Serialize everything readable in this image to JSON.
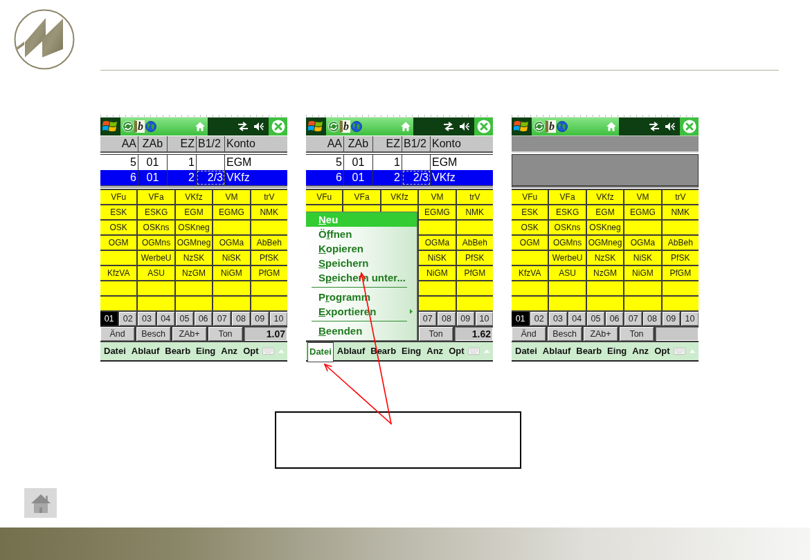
{
  "screens": [
    {
      "taskbar": {
        "app_badge": "b"
      },
      "table": {
        "columns": [
          "AA",
          "ZAb",
          "EZ",
          "B1/2",
          "Konto"
        ],
        "rows": [
          {
            "selected": false,
            "cells": [
              {
                "text": "5",
                "focused": false
              },
              {
                "text": "01",
                "focused": false
              },
              {
                "text": "1",
                "focused": false
              },
              {
                "focused": false
              },
              {
                "text": "EGM",
                "focused": false
              }
            ]
          },
          {
            "selected": true,
            "cells": [
              {
                "text": "6",
                "focused": false
              },
              {
                "text": "01",
                "focused": false
              },
              {
                "text": "2",
                "focused": false
              },
              {
                "text": "2/3",
                "focused": true
              },
              {
                "text": "VKfz",
                "focused": false
              }
            ]
          }
        ]
      },
      "grid": [
        [
          {
            "kind": "account",
            "label": "VFu"
          },
          {
            "kind": "account",
            "label": "VFa"
          },
          {
            "kind": "account",
            "label": "VKfz"
          },
          {
            "kind": "account",
            "label": "VM"
          },
          {
            "kind": "account",
            "label": "trV"
          }
        ],
        [
          {
            "kind": "account",
            "label": "ESK"
          },
          {
            "kind": "account",
            "label": "ESKG"
          },
          {
            "kind": "account",
            "label": "EGM"
          },
          {
            "kind": "account",
            "label": "EGMG"
          },
          {
            "kind": "account",
            "label": "NMK"
          }
        ],
        [
          {
            "kind": "account",
            "label": "OSK"
          },
          {
            "kind": "account",
            "label": "OSKns"
          },
          {
            "kind": "account",
            "label": "OSKneg"
          },
          {
            "kind": "blank"
          },
          {
            "kind": "blank"
          }
        ],
        [
          {
            "kind": "account",
            "label": "OGM"
          },
          {
            "kind": "account",
            "label": "OGMns"
          },
          {
            "kind": "account",
            "label": "OGMneg"
          },
          {
            "kind": "account",
            "label": "OGMa"
          },
          {
            "kind": "account",
            "label": "AbBeh"
          }
        ],
        [
          {
            "kind": "blank"
          },
          {
            "kind": "account",
            "label": "WerbeU"
          },
          {
            "kind": "account",
            "label": "NzSK"
          },
          {
            "kind": "account",
            "label": "NiSK"
          },
          {
            "kind": "account",
            "label": "PfSK"
          }
        ],
        [
          {
            "kind": "account",
            "label": "KfzVA"
          },
          {
            "kind": "account",
            "label": "ASU"
          },
          {
            "kind": "account",
            "label": "NzGM"
          },
          {
            "kind": "account",
            "label": "NiGM"
          },
          {
            "kind": "account",
            "label": "PfGM"
          }
        ],
        [
          {
            "kind": "blank"
          },
          {
            "kind": "blank"
          },
          {
            "kind": "blank"
          },
          {
            "kind": "blank"
          },
          {
            "kind": "blank"
          }
        ],
        [
          {
            "kind": "blank"
          },
          {
            "kind": "blank"
          },
          {
            "kind": "blank"
          },
          {
            "kind": "blank"
          },
          {
            "kind": "blank"
          }
        ]
      ],
      "tabs": [
        {
          "label": "01",
          "selected": true
        },
        {
          "label": "02",
          "selected": false
        },
        {
          "label": "03",
          "selected": false
        },
        {
          "label": "04",
          "selected": false
        },
        {
          "label": "05",
          "selected": false
        },
        {
          "label": "06",
          "selected": false
        },
        {
          "label": "07",
          "selected": false
        },
        {
          "label": "08",
          "selected": false
        },
        {
          "label": "09",
          "selected": false
        },
        {
          "label": "10",
          "selected": false
        }
      ],
      "buttons": [
        "Änd",
        "Besch",
        "ZAb+",
        "Ton"
      ],
      "value": "1.07",
      "menu_bar": [
        {
          "label": "Datei",
          "selected": false
        },
        {
          "label": "Ablauf",
          "selected": false
        },
        {
          "label": "Bearb",
          "selected": false
        },
        {
          "label": "Eing",
          "selected": false
        },
        {
          "label": "Anz",
          "selected": false
        },
        {
          "label": "Opt",
          "selected": false
        }
      ]
    },
    {
      "taskbar": {
        "app_badge": "b"
      },
      "table": {
        "columns": [
          "AA",
          "ZAb",
          "EZ",
          "B1/2",
          "Konto"
        ],
        "rows": [
          {
            "selected": false,
            "cells": [
              {
                "text": "5",
                "focused": false
              },
              {
                "text": "01",
                "focused": false
              },
              {
                "text": "1",
                "focused": false
              },
              {
                "focused": false
              },
              {
                "text": "EGM",
                "focused": false
              }
            ]
          },
          {
            "selected": true,
            "cells": [
              {
                "text": "6",
                "focused": false
              },
              {
                "text": "01",
                "focused": false
              },
              {
                "text": "2",
                "focused": false
              },
              {
                "text": "2/3",
                "focused": true
              },
              {
                "text": "VKfz",
                "focused": false
              }
            ]
          }
        ]
      },
      "grid": [
        [
          {
            "kind": "account",
            "label": "VFu"
          },
          {
            "kind": "account",
            "label": "VFa"
          },
          {
            "kind": "account",
            "label": "VKfz"
          },
          {
            "kind": "account",
            "label": "VM"
          },
          {
            "kind": "account",
            "label": "trV"
          }
        ],
        [
          {
            "kind": "account",
            "label": "EGMG"
          },
          {
            "kind": "account",
            "label": "NMK"
          }
        ],
        [
          {
            "kind": "blank"
          },
          {
            "kind": "blank"
          }
        ],
        [
          {
            "kind": "account",
            "label": "OGMa"
          },
          {
            "kind": "account",
            "label": "AbBeh"
          }
        ],
        [
          {
            "kind": "account",
            "label": "NiSK"
          },
          {
            "kind": "account",
            "label": "PfSK"
          }
        ],
        [
          {
            "kind": "account",
            "label": "NiGM"
          },
          {
            "kind": "account",
            "label": "PfGM"
          }
        ],
        [
          {
            "kind": "blank"
          },
          {
            "kind": "blank"
          }
        ],
        [
          {
            "kind": "blank"
          },
          {
            "kind": "blank"
          }
        ]
      ],
      "tabs": [
        {
          "label": "07",
          "selected": false
        },
        {
          "label": "08",
          "selected": false
        },
        {
          "label": "09",
          "selected": false
        },
        {
          "label": "10",
          "selected": false
        }
      ],
      "buttons": [
        "Ton"
      ],
      "value": "1.62",
      "menu": {
        "items": [
          {
            "kind": "item",
            "key": "N",
            "post": "eu",
            "selected": true,
            "submenu": false
          },
          {
            "kind": "item",
            "pre": "Ö",
            "key": "f",
            "post": "fnen",
            "selected": false,
            "submenu": false
          },
          {
            "kind": "item",
            "key": "K",
            "post": "opieren",
            "selected": false,
            "submenu": false
          },
          {
            "kind": "item",
            "key": "S",
            "post": "peichern",
            "selected": false,
            "submenu": false
          },
          {
            "kind": "item",
            "pre": "S",
            "key": "p",
            "post": "eichern unter...",
            "selected": false,
            "submenu": false
          },
          {
            "kind": "separator"
          },
          {
            "kind": "item",
            "pre": "P",
            "key": "r",
            "post": "ogramm",
            "selected": false,
            "submenu": false
          },
          {
            "kind": "item",
            "key": "E",
            "post": "xportieren",
            "selected": false,
            "submenu": true
          },
          {
            "kind": "separator"
          },
          {
            "kind": "item",
            "key": "B",
            "post": "eenden",
            "selected": false,
            "submenu": false
          }
        ]
      },
      "menu_bar": [
        {
          "label": "Datei",
          "selected": true
        },
        {
          "label": "Ablauf",
          "selected": false
        },
        {
          "label": "Bearb",
          "selected": false
        },
        {
          "label": "Eing",
          "selected": false
        },
        {
          "label": "Anz",
          "selected": false
        },
        {
          "label": "Opt",
          "selected": false
        }
      ]
    },
    {
      "taskbar": {
        "app_badge": "b"
      },
      "grid": [
        [
          {
            "kind": "account",
            "label": "VFu"
          },
          {
            "kind": "account",
            "label": "VFa"
          },
          {
            "kind": "account",
            "label": "VKfz"
          },
          {
            "kind": "account",
            "label": "VM"
          },
          {
            "kind": "account",
            "label": "trV"
          }
        ],
        [
          {
            "kind": "account",
            "label": "ESK"
          },
          {
            "kind": "account",
            "label": "ESKG"
          },
          {
            "kind": "account",
            "label": "EGM"
          },
          {
            "kind": "account",
            "label": "EGMG"
          },
          {
            "kind": "account",
            "label": "NMK"
          }
        ],
        [
          {
            "kind": "account",
            "label": "OSK"
          },
          {
            "kind": "account",
            "label": "OSKns"
          },
          {
            "kind": "account",
            "label": "OSKneg"
          },
          {
            "kind": "blank"
          },
          {
            "kind": "blank"
          }
        ],
        [
          {
            "kind": "account",
            "label": "OGM"
          },
          {
            "kind": "account",
            "label": "OGMns"
          },
          {
            "kind": "account",
            "label": "OGMneg"
          },
          {
            "kind": "account",
            "label": "OGMa"
          },
          {
            "kind": "account",
            "label": "AbBeh"
          }
        ],
        [
          {
            "kind": "blank"
          },
          {
            "kind": "account",
            "label": "WerbeU"
          },
          {
            "kind": "account",
            "label": "NzSK"
          },
          {
            "kind": "account",
            "label": "NiSK"
          },
          {
            "kind": "account",
            "label": "PfSK"
          }
        ],
        [
          {
            "kind": "account",
            "label": "KfzVA"
          },
          {
            "kind": "account",
            "label": "ASU"
          },
          {
            "kind": "account",
            "label": "NzGM"
          },
          {
            "kind": "account",
            "label": "NiGM"
          },
          {
            "kind": "account",
            "label": "PfGM"
          }
        ],
        [
          {
            "kind": "blank"
          },
          {
            "kind": "blank"
          },
          {
            "kind": "blank"
          },
          {
            "kind": "blank"
          },
          {
            "kind": "blank"
          }
        ],
        [
          {
            "kind": "blank"
          },
          {
            "kind": "blank"
          },
          {
            "kind": "blank"
          },
          {
            "kind": "blank"
          },
          {
            "kind": "blank"
          }
        ]
      ],
      "tabs": [
        {
          "label": "01",
          "selected": true
        },
        {
          "label": "02",
          "selected": false
        },
        {
          "label": "03",
          "selected": false
        },
        {
          "label": "04",
          "selected": false
        },
        {
          "label": "05",
          "selected": false
        },
        {
          "label": "06",
          "selected": false
        },
        {
          "label": "07",
          "selected": false
        },
        {
          "label": "08",
          "selected": false
        },
        {
          "label": "09",
          "selected": false
        },
        {
          "label": "10",
          "selected": false
        }
      ],
      "buttons": [
        "Änd",
        "Besch",
        "ZAb+",
        "Ton"
      ],
      "menu_bar": [
        {
          "label": "Datei",
          "selected": false
        },
        {
          "label": "Ablauf",
          "selected": false
        },
        {
          "label": "Bearb",
          "selected": false
        },
        {
          "label": "Eing",
          "selected": false
        },
        {
          "label": "Anz",
          "selected": false
        },
        {
          "label": "Opt",
          "selected": false
        }
      ]
    }
  ]
}
